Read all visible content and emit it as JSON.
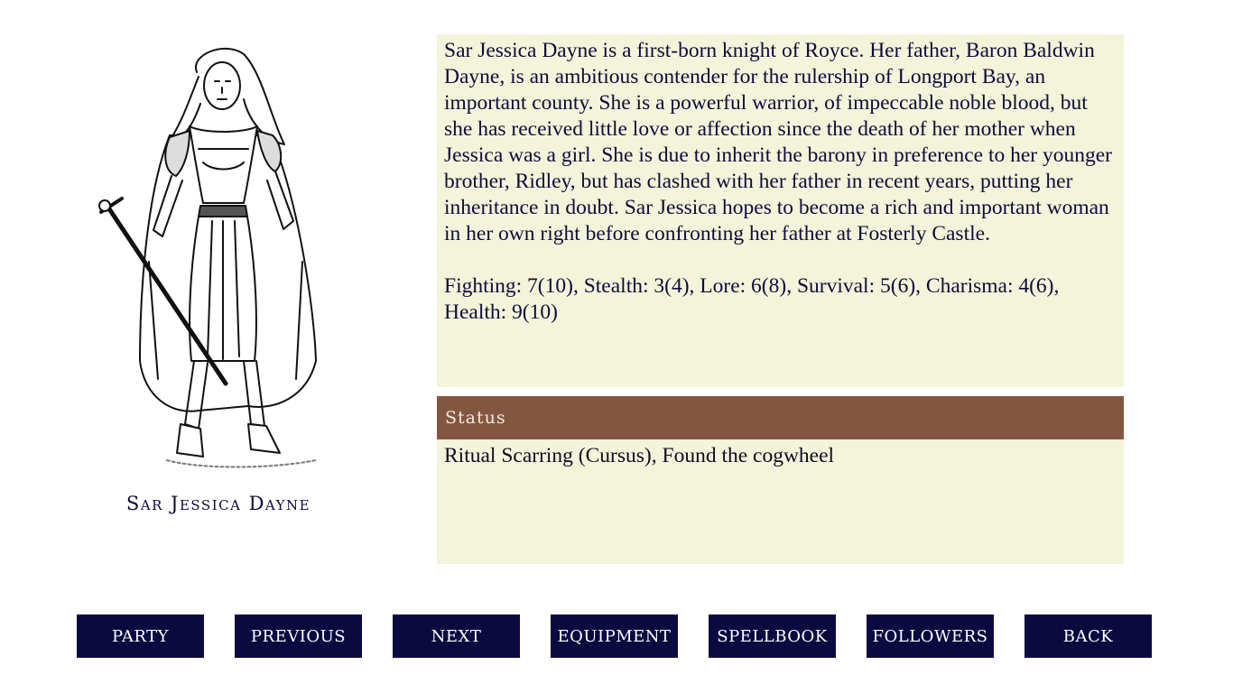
{
  "character": {
    "name": "Sar Jessica Dayne",
    "description": "Sar Jessica Dayne is a first-born knight of Royce. Her father, Baron Baldwin Dayne, is an ambitious contender for the rulership of Longport Bay, an important county. She is a powerful warrior, of impeccable noble blood, but she has received little love or affection since the death of her mother when Jessica was a girl. She is due to inherit the barony in preference to her younger brother, Ridley, but has clashed with her father in recent years, putting her inheritance in doubt. Sar Jessica hopes to become a rich and important woman in her own right before confronting her father at Fosterly Castle.",
    "stats": "Fighting: 7(10), Stealth: 3(4), Lore: 6(8), Survival: 5(6), Charisma: 4(6), Health: 9(10)",
    "portrait_icon": "knight-portrait"
  },
  "status": {
    "header": "Status",
    "text": "Ritual Scarring (Cursus), Found the cogwheel"
  },
  "buttons": {
    "party": "PARTY",
    "previous": "PREVIOUS",
    "next": "NEXT",
    "equipment": "EQUIPMENT",
    "spellbook": "SPELLBOOK",
    "followers": "FOLLOWERS",
    "back": "BACK"
  },
  "colors": {
    "panel_bg": "#f4f4da",
    "status_header_bg": "#845641",
    "button_bg": "#0a0940",
    "text_navy": "#0d0c3c"
  }
}
